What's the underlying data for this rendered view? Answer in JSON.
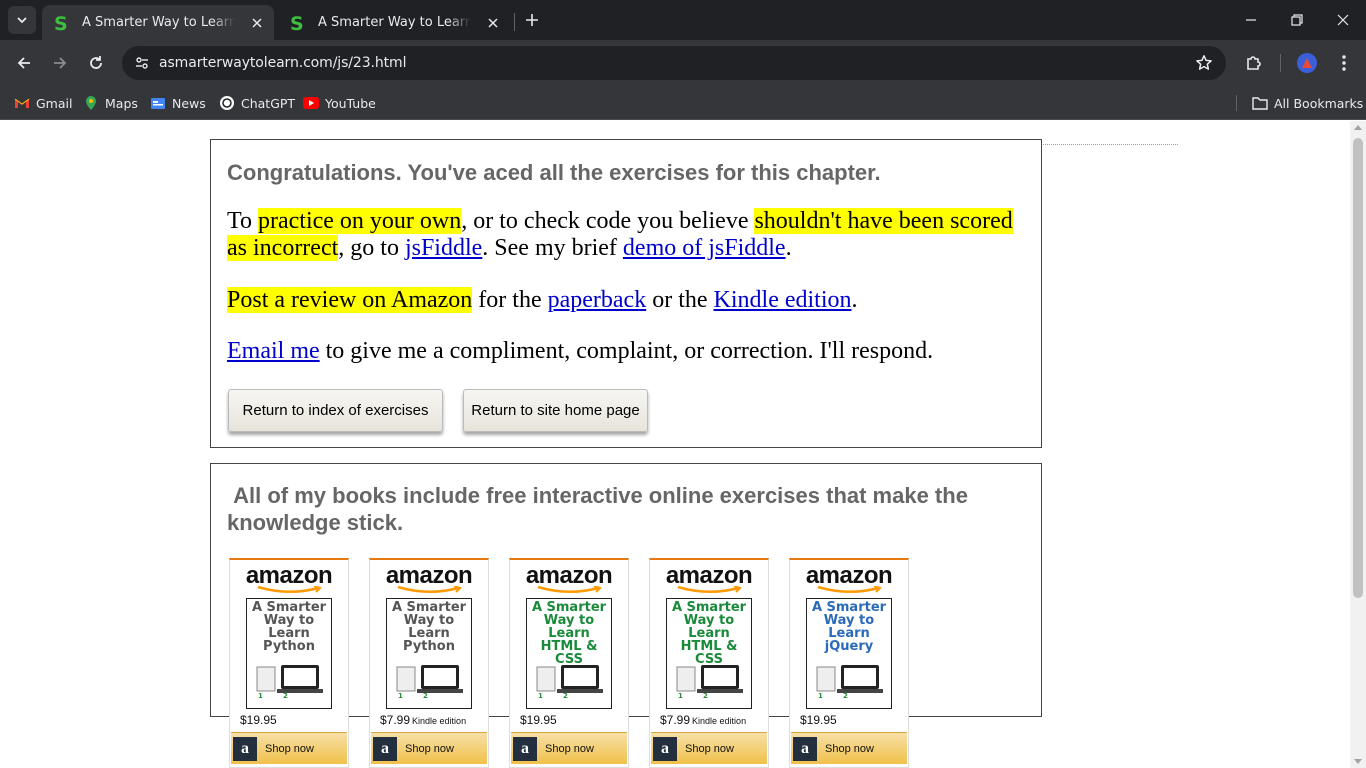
{
  "browser": {
    "tabs": [
      {
        "title": "A Smarter Way to Learn JavaScript",
        "active": true
      },
      {
        "title": "A Smarter Way to Learn JavaScript",
        "active": false
      }
    ],
    "url": "asmarterwaytolearn.com/js/23.html",
    "bookmarks": [
      {
        "label": "Gmail",
        "icon": "gmail-icon"
      },
      {
        "label": "Maps",
        "icon": "maps-icon"
      },
      {
        "label": "News",
        "icon": "news-icon"
      },
      {
        "label": "ChatGPT",
        "icon": "chatgpt-icon"
      },
      {
        "label": "YouTube",
        "icon": "youtube-icon"
      }
    ],
    "all_bookmarks": "All Bookmarks"
  },
  "congrats": {
    "heading": "Congratulations. You've aced all the exercises for this chapter.",
    "p1": {
      "t1": "To ",
      "h1": "practice on your own",
      "t2": ", or to check code you believe ",
      "h2": "shouldn't have been scored as incorrect",
      "t3": ", go to ",
      "link1": "jsFiddle",
      "t4": ". See my brief ",
      "link2": "demo of jsFiddle",
      "t5": "."
    },
    "p2": {
      "h1": "Post a review on Amazon",
      "t1": " for the ",
      "link1": "paperback",
      "t2": " or the ",
      "link2": "Kindle edition",
      "t3": "."
    },
    "p3": {
      "link1": "Email me",
      "t1": " to give me a compliment, complaint, or correction. I'll respond."
    },
    "buttons": {
      "index": "Return to index of exercises",
      "home": "Return to site home page"
    }
  },
  "books": {
    "heading": "All of my books include free interactive online exercises that make the knowledge stick.",
    "items": [
      {
        "logo": "amazon",
        "cover_title": "A Smarter Way to Learn Python",
        "cover_color": "#555555",
        "price": "$19.95",
        "edition": "",
        "shop": "Shop now"
      },
      {
        "logo": "amazon",
        "cover_title": "A Smarter Way to Learn Python",
        "cover_color": "#555555",
        "price": "$7.99",
        "edition": "Kindle edition",
        "shop": "Shop now"
      },
      {
        "logo": "amazon",
        "cover_title": "A Smarter Way to Learn HTML & CSS",
        "cover_color": "#1a8a3a",
        "price": "$19.95",
        "edition": "",
        "shop": "Shop now"
      },
      {
        "logo": "amazon",
        "cover_title": "A Smarter Way to Learn HTML & CSS",
        "cover_color": "#1a8a3a",
        "price": "$7.99",
        "edition": "Kindle edition",
        "shop": "Shop now"
      },
      {
        "logo": "amazon",
        "cover_title": "A Smarter Way to Learn jQuery",
        "cover_color": "#2a6ab8",
        "price": "$19.95",
        "edition": "",
        "shop": "Shop now"
      }
    ]
  },
  "colors": {
    "highlight": "#ffff00",
    "link": "#0000cc",
    "heading_gray": "#666666",
    "amazon_orange": "#e47911"
  }
}
